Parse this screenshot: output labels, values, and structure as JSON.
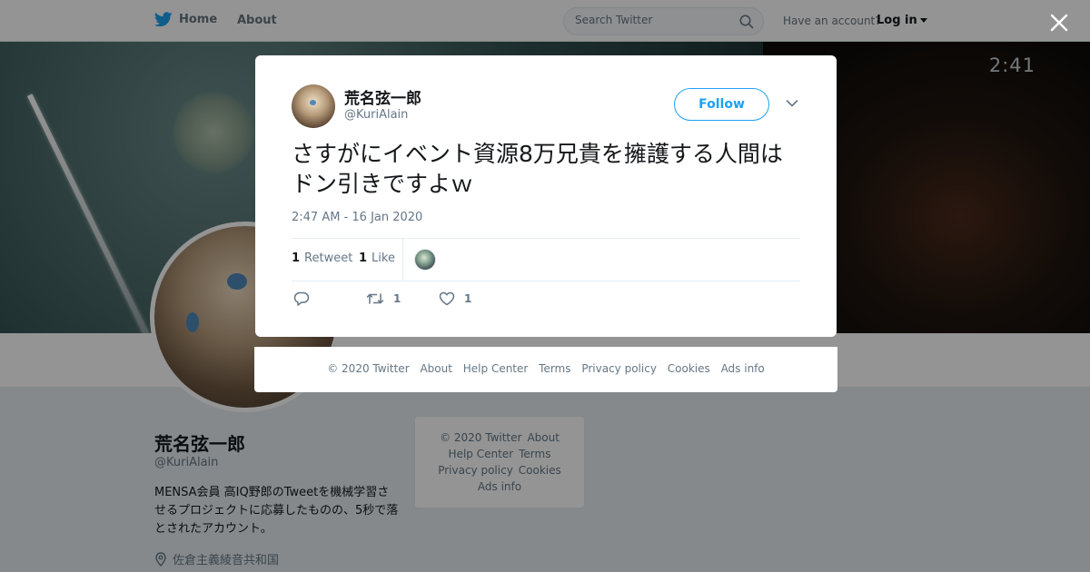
{
  "nav": {
    "home_label": "Home",
    "about_label": "About",
    "search_placeholder": "Search Twitter",
    "have_account": "Have an account?",
    "login_label": "Log in"
  },
  "banner": {
    "time_text": "2:41"
  },
  "profile": {
    "name": "荒名弦一郎",
    "handle": "@KuriAlain",
    "bio": "MENSA会員 高IQ野郎のTweetを機械学習させるプロジェクトに応募したものの、5秒で落とされたアカウント。",
    "location": "佐倉主義綾音共和国"
  },
  "side_footer": {
    "copyright": "© 2020 Twitter",
    "about": "About",
    "help_center": "Help Center",
    "terms": "Terms",
    "privacy": "Privacy policy",
    "cookies": "Cookies",
    "ads_info": "Ads info"
  },
  "tweet": {
    "author_name": "荒名弦一郎",
    "author_handle": "@KuriAlain",
    "follow_label": "Follow",
    "text": "さすがにイベント資源8万兄貴を擁護する人間はドン引きですよｗ",
    "timestamp": "2:47 AM - 16 Jan 2020",
    "retweet_count": "1",
    "retweet_label": "Retweet",
    "like_count": "1",
    "like_label": "Like",
    "action_retweet_count": "1",
    "action_like_count": "1"
  },
  "modal_footer": {
    "copyright": "© 2020 Twitter",
    "about": "About",
    "help_center": "Help Center",
    "terms": "Terms",
    "privacy": "Privacy policy",
    "cookies": "Cookies",
    "ads_info": "Ads info"
  },
  "colors": {
    "brand_blue": "#1da1f2",
    "text_primary": "#14171a",
    "text_secondary": "#657786",
    "background": "#e6ecf0"
  },
  "icons": [
    "twitter-bird-icon",
    "search-icon",
    "caret-down-icon",
    "close-icon",
    "chevron-down-icon",
    "reply-icon",
    "retweet-icon",
    "heart-icon",
    "location-pin-icon"
  ]
}
